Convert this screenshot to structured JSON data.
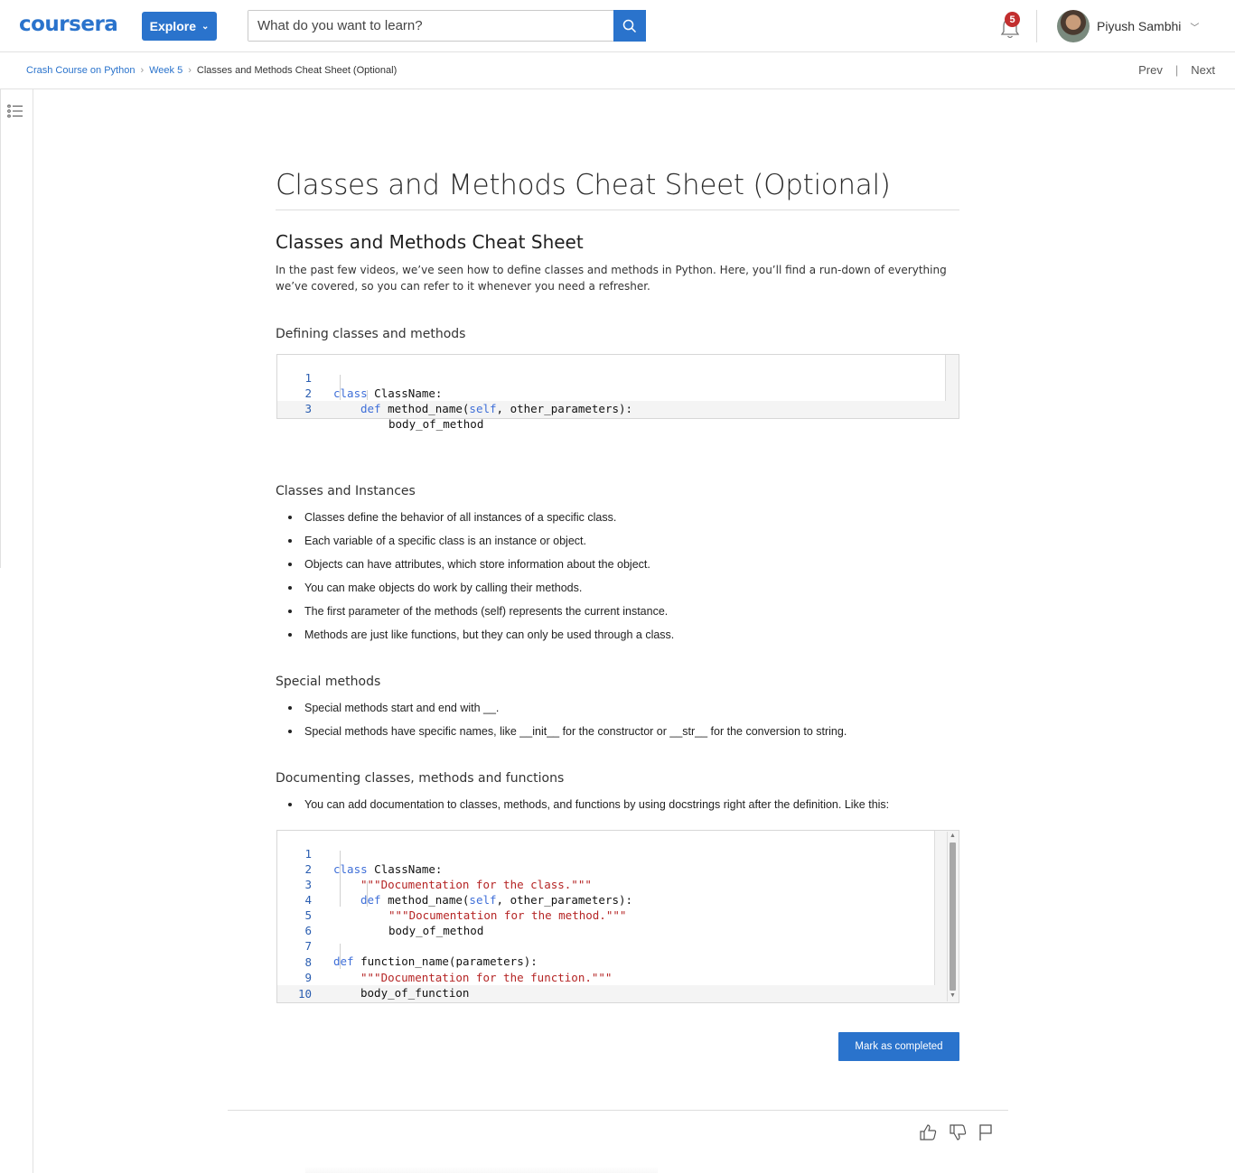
{
  "header": {
    "logo": "coursera",
    "explore_label": "Explore",
    "search_placeholder": "What do you want to learn?",
    "notification_count": "5",
    "user_name": "Piyush Sambhi"
  },
  "breadcrumb": {
    "items": [
      "Crash Course on Python",
      "Week 5"
    ],
    "current": "Classes and Methods Cheat Sheet (Optional)",
    "prev_label": "Prev",
    "separator": "|",
    "next_label": "Next"
  },
  "page": {
    "title": "Classes and Methods Cheat Sheet (Optional)",
    "subtitle": "Classes and Methods Cheat Sheet",
    "intro": "In the past few videos, we’ve seen how to define classes and methods in Python. Here, you’ll find a run-down of everything we’ve covered, so you can refer to it whenever you need a refresher.",
    "sections": {
      "defining": {
        "heading": "Defining classes and methods",
        "code_lines": [
          {
            "n": "1",
            "kw": "class",
            "rest": " ClassName:"
          },
          {
            "n": "2",
            "kw": "def",
            "rest": " method_name(",
            "self": "self",
            "rest2": ", other_parameters):"
          },
          {
            "n": "3",
            "text": "body_of_method"
          }
        ]
      },
      "instances": {
        "heading": "Classes and Instances",
        "bullets": [
          "Classes define the behavior of all instances of a specific class.",
          "Each variable of a specific class is an instance or object.",
          "Objects can have attributes, which store information about the object.",
          "You can make objects do work by calling their methods.",
          "The first parameter of the methods (self) represents the current instance.",
          "Methods are just like functions, but they can only be used through a class."
        ]
      },
      "special": {
        "heading": "Special methods",
        "bullets": [
          "Special methods start and end with __.",
          "Special methods have specific names, like __init__ for the constructor or __str__ for the conversion to string."
        ]
      },
      "documenting": {
        "heading": "Documenting classes, methods and functions",
        "bullets": [
          "You can add documentation to classes, methods, and functions by using docstrings right after the definition. Like this:"
        ],
        "line_numbers": [
          "1",
          "2",
          "3",
          "4",
          "5",
          "6",
          "7",
          "8",
          "9",
          "10"
        ],
        "code": {
          "l1_kw": "class",
          "l1_rest": " ClassName:",
          "l2_str": "\"\"\"Documentation for the class.\"\"\"",
          "l3_kw": "def",
          "l3_rest": " method_name(",
          "l3_self": "self",
          "l3_rest2": ", other_parameters):",
          "l4_str": "\"\"\"Documentation for the method.\"\"\"",
          "l5_text": "body_of_method",
          "l7_kw": "def",
          "l7_rest": " function_name(parameters):",
          "l8_str": "\"\"\"Documentation for the function.\"\"\"",
          "l9_text": "body_of_function"
        }
      }
    },
    "mark_completed_label": "Mark as completed"
  },
  "colors": {
    "brand": "#2a73cc",
    "badge": "#c22e2e",
    "keyword": "#3f6fd8",
    "string": "#b52525"
  },
  "icons": [
    "search-icon",
    "bell-icon",
    "chevron-down-icon",
    "toc-list-icon",
    "thumbs-up-icon",
    "thumbs-down-icon",
    "flag-icon"
  ]
}
